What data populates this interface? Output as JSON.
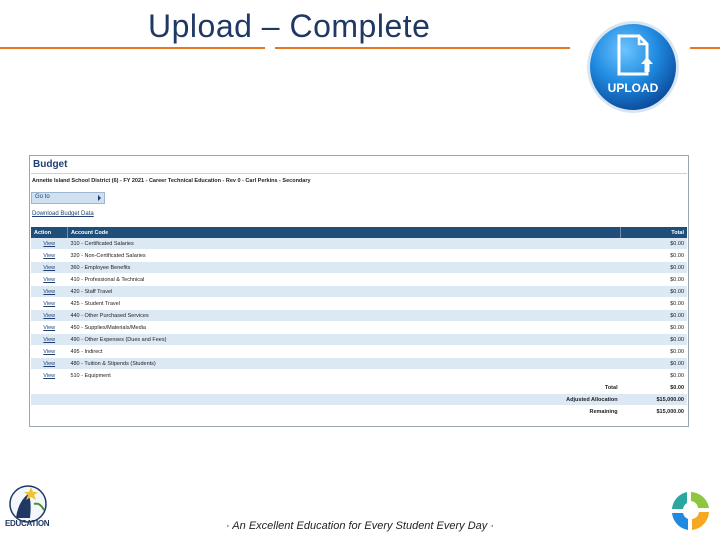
{
  "slide": {
    "title": "Upload – Complete",
    "footer": "· An Excellent Education for Every Student Every Day ·",
    "upload_badge_label": "UPLOAD",
    "education_logo_label": "EDUCATION"
  },
  "budget": {
    "title": "Budget",
    "district_line": "Annette Island School District (6) - FY 2021 - Career Technical Education - Rev 0 - Carl Perkins - Secondary",
    "goto_label": "Go to",
    "download_link": "Download Budget Data",
    "columns": {
      "action": "Action",
      "account_code": "Account Code",
      "total": "Total"
    },
    "rows": [
      {
        "action": "View",
        "code": "310 - Certificated Salaries",
        "total": "$0.00"
      },
      {
        "action": "View",
        "code": "320 - Non-Certificated Salaries",
        "total": "$0.00"
      },
      {
        "action": "View",
        "code": "360 - Employee Benefits",
        "total": "$0.00"
      },
      {
        "action": "View",
        "code": "410 - Professional & Technical",
        "total": "$0.00"
      },
      {
        "action": "View",
        "code": "420 - Staff Travel",
        "total": "$0.00"
      },
      {
        "action": "View",
        "code": "425 - Student Travel",
        "total": "$0.00"
      },
      {
        "action": "View",
        "code": "440 - Other Purchased Services",
        "total": "$0.00"
      },
      {
        "action": "View",
        "code": "450 - Supplies/Materials/Media",
        "total": "$0.00"
      },
      {
        "action": "View",
        "code": "490 - Other Expenses (Dues and Fees)",
        "total": "$0.00"
      },
      {
        "action": "View",
        "code": "495 - Indirect",
        "total": "$0.00"
      },
      {
        "action": "View",
        "code": "480 - Tuition & Stipends (Students)",
        "total": "$0.00"
      },
      {
        "action": "View",
        "code": "510 - Equipment",
        "total": "$0.00"
      }
    ],
    "summary": [
      {
        "label": "Total",
        "value": "$0.00"
      },
      {
        "label": "Adjusted Allocation",
        "value": "$15,000.00"
      },
      {
        "label": "Remaining",
        "value": "$15,000.00"
      }
    ]
  },
  "colors": {
    "title": "#1f3864",
    "accent_rule": "#e87722",
    "header_bar": "#1f4e79",
    "row_alt": "#dce8f3",
    "badge": "#1f8ae0"
  }
}
